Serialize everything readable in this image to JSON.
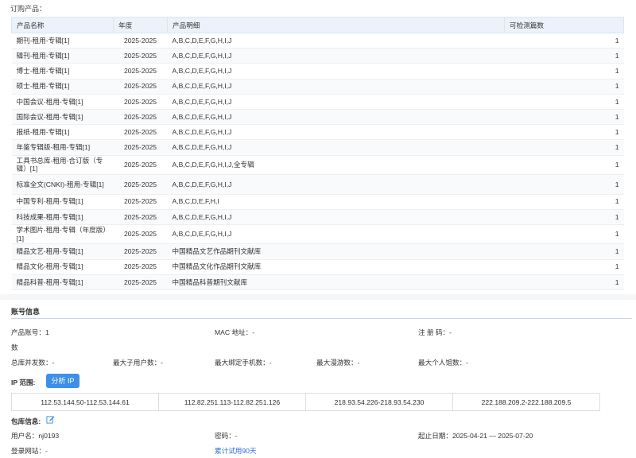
{
  "section_title": "订购产品：",
  "products": {
    "headers": {
      "name": "产品名称",
      "year": "年度",
      "detail": "产品明细",
      "count": "可检测篇数"
    },
    "rows": [
      {
        "name": "期刊-租用-专辑[1]",
        "year": "2025-2025",
        "detail": "A,B,C,D,E,F,G,H,I,J",
        "count": "1"
      },
      {
        "name": "辑刊-租用-专辑[1]",
        "year": "2025-2025",
        "detail": "A,B,C,D,E,F,G,H,I,J",
        "count": "1"
      },
      {
        "name": "博士-租用-专辑[1]",
        "year": "2025-2025",
        "detail": "A,B,C,D,E,F,G,H,I,J",
        "count": "1"
      },
      {
        "name": "硕士-租用-专辑[1]",
        "year": "2025-2025",
        "detail": "A,B,C,D,E,F,G,H,I,J",
        "count": "1"
      },
      {
        "name": "中国会议-租用-专辑[1]",
        "year": "2025-2025",
        "detail": "A,B,C,D,E,F,G,H,I,J",
        "count": "1"
      },
      {
        "name": "国际会议-租用-专辑[1]",
        "year": "2025-2025",
        "detail": "A,B,C,D,E,F,G,H,I,J",
        "count": "1"
      },
      {
        "name": "报纸-租用-专辑[1]",
        "year": "2025-2025",
        "detail": "A,B,C,D,E,F,G,H,I,J",
        "count": "1"
      },
      {
        "name": "年鉴专辑版-租用-专辑[1]",
        "year": "2025-2025",
        "detail": "A,B,C,D,E,F,G,H,I,J",
        "count": "1"
      },
      {
        "name": "工具书总库-租用-合订版（专辑）[1]",
        "year": "2025-2025",
        "detail": "A,B,C,D,E,F,G,H,I,J,全专辑",
        "count": "1"
      },
      {
        "name": "标准全文(CNKI)-租用-专辑[1]",
        "year": "2025-2025",
        "detail": "A,B,C,D,E,F,G,H,I,J",
        "count": "1"
      },
      {
        "name": "中国专利-租用-专辑[1]",
        "year": "2025-2025",
        "detail": "A,B,C,D,E,F,H,I",
        "count": "1"
      },
      {
        "name": "科技成果-租用-专辑[1]",
        "year": "2025-2025",
        "detail": "A,B,C,D,E,F,G,H,I,J",
        "count": "1"
      },
      {
        "name": "学术图片-租用-专辑（年度版）[1]",
        "year": "2025-2025",
        "detail": "A,B,C,D,E,F,G,H,I,J",
        "count": "1"
      },
      {
        "name": "精品文艺-租用-专辑[1]",
        "year": "2025-2025",
        "detail": "中国精品文艺作品期刊文献库",
        "count": "1"
      },
      {
        "name": "精品文化-租用-专辑[1]",
        "year": "2025-2025",
        "detail": "中国精品文化作品期刊文献库",
        "count": "1"
      },
      {
        "name": "精品科普-租用-专辑[1]",
        "year": "2025-2025",
        "detail": "中国精品科普期刊文献库",
        "count": "1"
      }
    ]
  },
  "account": {
    "title": "账号信息",
    "product_count_label": "产品账号：1",
    "product_count_wrap": "数",
    "mac_label": "MAC 地址：-",
    "reg_label": "注  册  码：-",
    "concurrency_label": "总库并发数：-",
    "max_sub_users_label": "最大子用户数：-",
    "max_phones_label": "最大绑定手机数：-",
    "max_roaming_label": "最大漫游数：-",
    "max_personal_label": "最大个人馆数：-",
    "ip_label": "IP 范围:",
    "ip_button": "分析 IP",
    "ip_ranges": [
      "112.53.144.50-112.53.144.61",
      "112.82.251.113-112.82.251.126",
      "218.93.54.226-218.93.54.230",
      "222.188.209.2-222.188.209.5"
    ],
    "pkg_label": "包库信息:",
    "username_label": "用户名：nj0193",
    "password_label": "密码：-",
    "date_label": "起止日期：2025-04-21 — 2025-07-20",
    "login_site_label": "登录网站：-",
    "trial_link": "累计试用90天"
  },
  "colors": {
    "header_bg": "#eaf3fb",
    "accent": "#3d8fe8",
    "link": "#2d6fd2"
  },
  "icons": {
    "edit": "edit-icon"
  }
}
